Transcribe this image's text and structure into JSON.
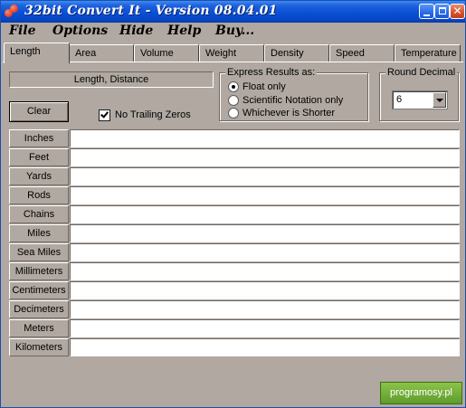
{
  "window": {
    "title": "32bit Convert It - Version 08.04.01"
  },
  "menu": [
    "File",
    "Options",
    "Hide",
    "Help",
    "Buy..."
  ],
  "tabs": [
    "Length",
    "Area",
    "Volume",
    "Weight",
    "Density",
    "Speed",
    "Temperature"
  ],
  "active_tab": "Length",
  "category": "Length, Distance",
  "clear_label": "Clear",
  "no_trailing_zeros": {
    "label": "No Trailing Zeros",
    "checked": true
  },
  "express": {
    "title": "Express Results as:",
    "options": [
      "Float only",
      "Scientific Notation only",
      "Whichever is Shorter"
    ],
    "selected": "Float only"
  },
  "round": {
    "title": "Round Decimal",
    "value": "6"
  },
  "units": [
    "Inches",
    "Feet",
    "Yards",
    "Rods",
    "Chains",
    "Miles",
    "Sea Miles",
    "Millimeters",
    "Centimeters",
    "Decimeters",
    "Meters",
    "Kilometers"
  ],
  "watermark": "programosy.pl"
}
